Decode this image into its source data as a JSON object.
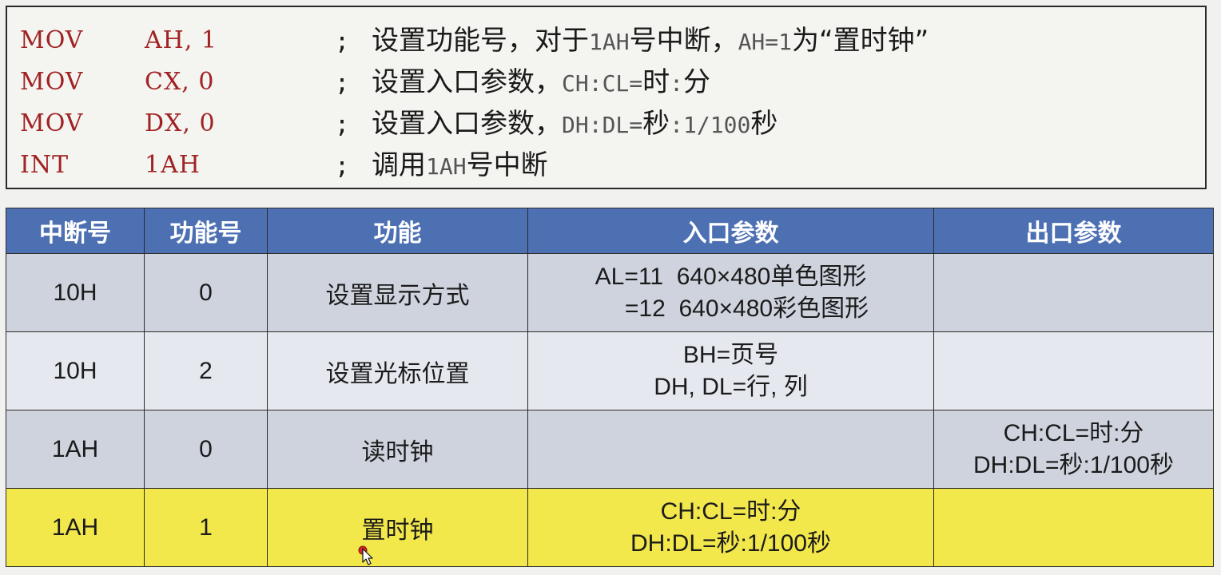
{
  "code": [
    {
      "op": "MOV",
      "arg": "AH, 1",
      "semi": ";",
      "comment": [
        {
          "t": "设置功能号，对于"
        },
        {
          "t": "1AH",
          "mono": true
        },
        {
          "t": "号中断，"
        },
        {
          "t": "AH=1",
          "mono": true
        },
        {
          "t": "为“置时钟”"
        }
      ]
    },
    {
      "op": "MOV",
      "arg": "CX, 0",
      "semi": ";",
      "comment": [
        {
          "t": "设置入口参数，"
        },
        {
          "t": "CH:CL=",
          "mono": true
        },
        {
          "t": "时"
        },
        {
          "t": ":",
          "mono": true
        },
        {
          "t": "分"
        }
      ]
    },
    {
      "op": "MOV",
      "arg": "DX, 0",
      "semi": ";",
      "comment": [
        {
          "t": "设置入口参数，"
        },
        {
          "t": "DH:DL=",
          "mono": true
        },
        {
          "t": "秒"
        },
        {
          "t": ":1/100",
          "mono": true
        },
        {
          "t": "秒"
        }
      ]
    },
    {
      "op": "INT",
      "arg": "1AH",
      "semi": ";",
      "comment": [
        {
          "t": "调用"
        },
        {
          "t": "1AH",
          "mono": true
        },
        {
          "t": "号中断"
        }
      ]
    }
  ],
  "table": {
    "headers": [
      "中断号",
      "功能号",
      "功能",
      "入口参数",
      "出口参数"
    ],
    "rows": [
      {
        "int": "10H",
        "func_no": "0",
        "func": "设置显示方式",
        "entry": [
          "AL=11  640×480单色图形",
          "=12  640×480彩色图形"
        ],
        "exit": []
      },
      {
        "int": "10H",
        "func_no": "2",
        "func": "设置光标位置",
        "entry": [
          "BH=页号",
          "DH, DL=行, 列"
        ],
        "exit": []
      },
      {
        "int": "1AH",
        "func_no": "0",
        "func": "读时钟",
        "entry": [],
        "exit": [
          "CH:CL=时:分",
          "DH:DL=秒:1/100秒"
        ]
      },
      {
        "int": "1AH",
        "func_no": "1",
        "func": "置时钟",
        "entry": [
          "CH:CL=时:分",
          "DH:DL=秒:1/100秒"
        ],
        "exit": [],
        "highlight": true
      }
    ]
  },
  "colors": {
    "header_bg": "#4d70b3",
    "row_dark": "#cfd3de",
    "row_light": "#e6e8ef",
    "highlight": "#f2e74b",
    "code_red": "#a02323"
  },
  "icons": {
    "cursor": "pointer-cursor-icon"
  }
}
